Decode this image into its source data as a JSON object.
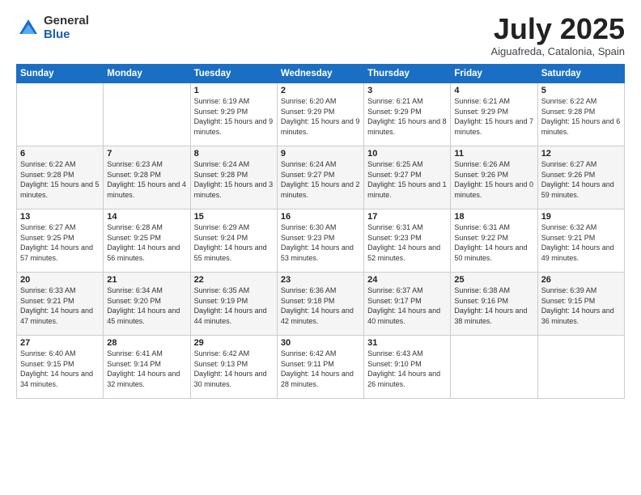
{
  "logo": {
    "general": "General",
    "blue": "Blue"
  },
  "title": "July 2025",
  "location": "Aiguafreda, Catalonia, Spain",
  "days_of_week": [
    "Sunday",
    "Monday",
    "Tuesday",
    "Wednesday",
    "Thursday",
    "Friday",
    "Saturday"
  ],
  "weeks": [
    [
      {
        "day": "",
        "info": ""
      },
      {
        "day": "",
        "info": ""
      },
      {
        "day": "1",
        "info": "Sunrise: 6:19 AM\nSunset: 9:29 PM\nDaylight: 15 hours and 9 minutes."
      },
      {
        "day": "2",
        "info": "Sunrise: 6:20 AM\nSunset: 9:29 PM\nDaylight: 15 hours and 9 minutes."
      },
      {
        "day": "3",
        "info": "Sunrise: 6:21 AM\nSunset: 9:29 PM\nDaylight: 15 hours and 8 minutes."
      },
      {
        "day": "4",
        "info": "Sunrise: 6:21 AM\nSunset: 9:29 PM\nDaylight: 15 hours and 7 minutes."
      },
      {
        "day": "5",
        "info": "Sunrise: 6:22 AM\nSunset: 9:28 PM\nDaylight: 15 hours and 6 minutes."
      }
    ],
    [
      {
        "day": "6",
        "info": "Sunrise: 6:22 AM\nSunset: 9:28 PM\nDaylight: 15 hours and 5 minutes."
      },
      {
        "day": "7",
        "info": "Sunrise: 6:23 AM\nSunset: 9:28 PM\nDaylight: 15 hours and 4 minutes."
      },
      {
        "day": "8",
        "info": "Sunrise: 6:24 AM\nSunset: 9:28 PM\nDaylight: 15 hours and 3 minutes."
      },
      {
        "day": "9",
        "info": "Sunrise: 6:24 AM\nSunset: 9:27 PM\nDaylight: 15 hours and 2 minutes."
      },
      {
        "day": "10",
        "info": "Sunrise: 6:25 AM\nSunset: 9:27 PM\nDaylight: 15 hours and 1 minute."
      },
      {
        "day": "11",
        "info": "Sunrise: 6:26 AM\nSunset: 9:26 PM\nDaylight: 15 hours and 0 minutes."
      },
      {
        "day": "12",
        "info": "Sunrise: 6:27 AM\nSunset: 9:26 PM\nDaylight: 14 hours and 59 minutes."
      }
    ],
    [
      {
        "day": "13",
        "info": "Sunrise: 6:27 AM\nSunset: 9:25 PM\nDaylight: 14 hours and 57 minutes."
      },
      {
        "day": "14",
        "info": "Sunrise: 6:28 AM\nSunset: 9:25 PM\nDaylight: 14 hours and 56 minutes."
      },
      {
        "day": "15",
        "info": "Sunrise: 6:29 AM\nSunset: 9:24 PM\nDaylight: 14 hours and 55 minutes."
      },
      {
        "day": "16",
        "info": "Sunrise: 6:30 AM\nSunset: 9:23 PM\nDaylight: 14 hours and 53 minutes."
      },
      {
        "day": "17",
        "info": "Sunrise: 6:31 AM\nSunset: 9:23 PM\nDaylight: 14 hours and 52 minutes."
      },
      {
        "day": "18",
        "info": "Sunrise: 6:31 AM\nSunset: 9:22 PM\nDaylight: 14 hours and 50 minutes."
      },
      {
        "day": "19",
        "info": "Sunrise: 6:32 AM\nSunset: 9:21 PM\nDaylight: 14 hours and 49 minutes."
      }
    ],
    [
      {
        "day": "20",
        "info": "Sunrise: 6:33 AM\nSunset: 9:21 PM\nDaylight: 14 hours and 47 minutes."
      },
      {
        "day": "21",
        "info": "Sunrise: 6:34 AM\nSunset: 9:20 PM\nDaylight: 14 hours and 45 minutes."
      },
      {
        "day": "22",
        "info": "Sunrise: 6:35 AM\nSunset: 9:19 PM\nDaylight: 14 hours and 44 minutes."
      },
      {
        "day": "23",
        "info": "Sunrise: 6:36 AM\nSunset: 9:18 PM\nDaylight: 14 hours and 42 minutes."
      },
      {
        "day": "24",
        "info": "Sunrise: 6:37 AM\nSunset: 9:17 PM\nDaylight: 14 hours and 40 minutes."
      },
      {
        "day": "25",
        "info": "Sunrise: 6:38 AM\nSunset: 9:16 PM\nDaylight: 14 hours and 38 minutes."
      },
      {
        "day": "26",
        "info": "Sunrise: 6:39 AM\nSunset: 9:15 PM\nDaylight: 14 hours and 36 minutes."
      }
    ],
    [
      {
        "day": "27",
        "info": "Sunrise: 6:40 AM\nSunset: 9:15 PM\nDaylight: 14 hours and 34 minutes."
      },
      {
        "day": "28",
        "info": "Sunrise: 6:41 AM\nSunset: 9:14 PM\nDaylight: 14 hours and 32 minutes."
      },
      {
        "day": "29",
        "info": "Sunrise: 6:42 AM\nSunset: 9:13 PM\nDaylight: 14 hours and 30 minutes."
      },
      {
        "day": "30",
        "info": "Sunrise: 6:42 AM\nSunset: 9:11 PM\nDaylight: 14 hours and 28 minutes."
      },
      {
        "day": "31",
        "info": "Sunrise: 6:43 AM\nSunset: 9:10 PM\nDaylight: 14 hours and 26 minutes."
      },
      {
        "day": "",
        "info": ""
      },
      {
        "day": "",
        "info": ""
      }
    ]
  ]
}
